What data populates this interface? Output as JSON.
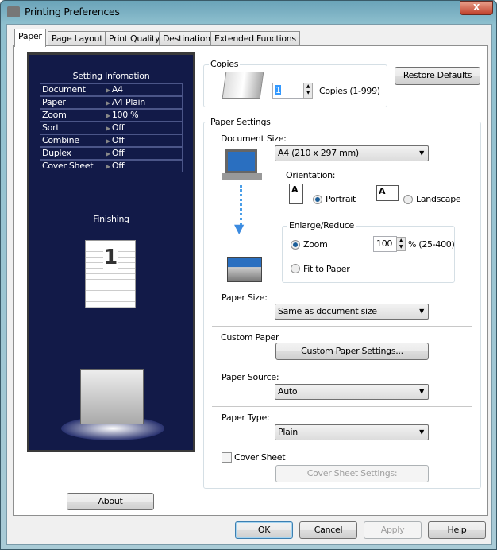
{
  "window": {
    "title": "Printing Preferences",
    "close": "X"
  },
  "tabs": [
    "Paper",
    "Page Layout",
    "Print Quality",
    "Destination",
    "Extended Functions"
  ],
  "setting_info": {
    "title": "Setting Infomation",
    "rows": [
      {
        "label": "Document",
        "value": "A4"
      },
      {
        "label": "Paper",
        "value": "A4 Plain"
      },
      {
        "label": "Zoom",
        "value": "100 %"
      },
      {
        "label": "Sort",
        "value": "Off"
      },
      {
        "label": "Combine",
        "value": "Off"
      },
      {
        "label": "Duplex",
        "value": "Off"
      },
      {
        "label": "Cover Sheet",
        "value": "Off"
      }
    ]
  },
  "finishing": {
    "label": "Finishing",
    "page_number": "1"
  },
  "about": "About",
  "copies": {
    "label": "Copies",
    "value": "1",
    "range": "Copies (1-999)"
  },
  "restore_defaults": "Restore Defaults",
  "paper_settings": {
    "label": "Paper Settings",
    "document_size_label": "Document Size:",
    "document_size": "A4 (210 x 297 mm)",
    "orientation_label": "Orientation:",
    "portrait": "Portrait",
    "landscape": "Landscape",
    "orientation_selected": "Portrait",
    "enlarge_label": "Enlarge/Reduce",
    "zoom_label": "Zoom",
    "zoom_value": "100",
    "zoom_range": "% (25-400)",
    "fit_label": "Fit to Paper",
    "paper_size_label": "Paper Size:",
    "paper_size": "Same as document size",
    "custom_paper_label": "Custom Paper",
    "custom_paper_button": "Custom Paper Settings...",
    "paper_source_label": "Paper Source:",
    "paper_source": "Auto",
    "paper_type_label": "Paper Type:",
    "paper_type": "Plain",
    "cover_sheet_label": "Cover Sheet",
    "cover_sheet_checked": false,
    "cover_sheet_button": "Cover Sheet Settings:"
  },
  "footer": {
    "ok": "OK",
    "cancel": "Cancel",
    "apply": "Apply",
    "help": "Help"
  }
}
